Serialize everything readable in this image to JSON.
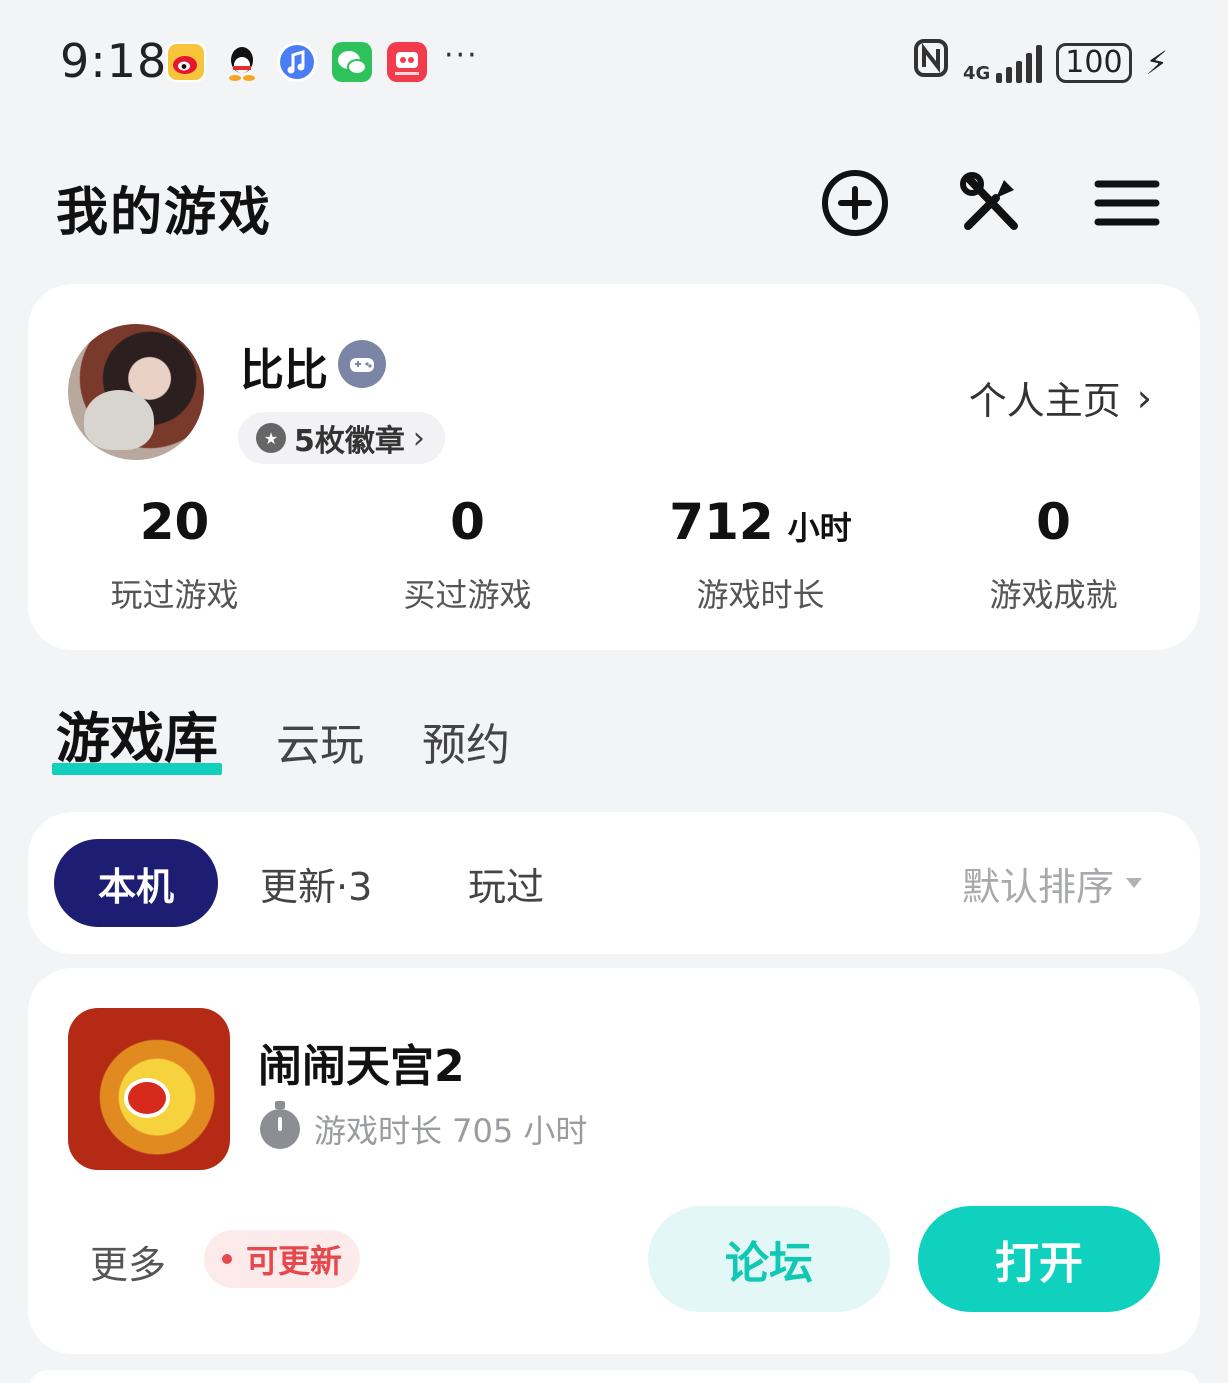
{
  "status_bar": {
    "time": "9:18",
    "notification_icons": [
      "weibo-icon",
      "qq-icon",
      "music-icon",
      "wechat-icon",
      "video-app-icon"
    ],
    "overflow": "···",
    "network": "4G",
    "battery": "100"
  },
  "header": {
    "title": "我的游戏",
    "icons": [
      "add-circle-icon",
      "tools-icon",
      "menu-icon"
    ]
  },
  "profile": {
    "name": "比比",
    "badges_label": "5枚徽章",
    "homepage_label": "个人主页",
    "stats": [
      {
        "value": "20",
        "unit": "",
        "label": "玩过游戏"
      },
      {
        "value": "0",
        "unit": "",
        "label": "买过游戏"
      },
      {
        "value": "712",
        "unit": "小时",
        "label": "游戏时长"
      },
      {
        "value": "0",
        "unit": "",
        "label": "游戏成就"
      }
    ]
  },
  "tabs": [
    {
      "label": "游戏库",
      "active": true
    },
    {
      "label": "云玩",
      "active": false
    },
    {
      "label": "预约",
      "active": false
    }
  ],
  "filters": {
    "chips": [
      "本机",
      "更新·3",
      "玩过"
    ],
    "active": "本机",
    "sort_label": "默认排序"
  },
  "games": [
    {
      "title": "闹闹天宫2",
      "playtime": "游戏时长 705 小时",
      "more_label": "更多",
      "update_tag": "可更新",
      "forum_label": "论坛",
      "open_label": "打开"
    }
  ],
  "colors": {
    "accent": "#10d0be",
    "chip_active": "#1c1d73",
    "update_red": "#e5484d",
    "background": "#f3f4f6"
  }
}
